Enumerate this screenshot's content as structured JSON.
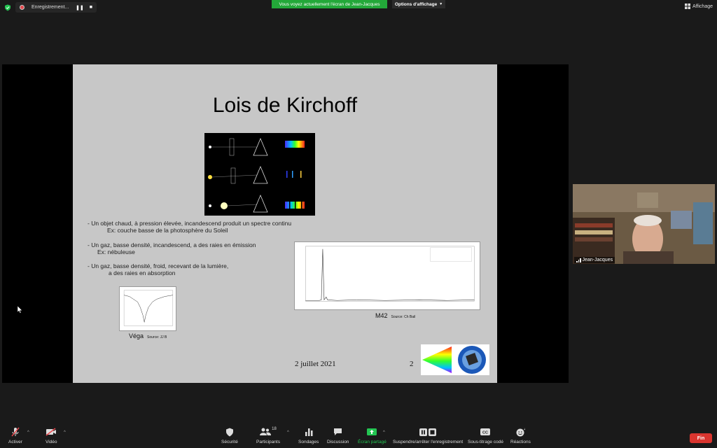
{
  "top_bar": {
    "recording_label": "Enregistrement...",
    "share_banner": "Vous voyez actuellement l'écran de Jean-Jacques",
    "view_options": "Options d'affichage",
    "view_button": "Affichage"
  },
  "slide": {
    "title": "Lois de Kirchoff",
    "bullet1_line1": "- Un objet chaud, à pression élevée, incandescend produit un spectre continu",
    "bullet1_line2": "Ex: couche basse de la photosphère du Soleil",
    "bullet2_line1": "- Un gaz, basse densité, incandescend, a  des raies en émission",
    "bullet2_line2": "Ex: nébuleuse",
    "bullet3_line1": "- Un gaz, basse densité, froid,  recevant de la lumière,",
    "bullet3_line2": "a des raies en absorption",
    "vega_caption": "Véga",
    "vega_source": "Source: JJ B",
    "m42_caption": "M42",
    "m42_source": "Source: Ch Bail",
    "date": "2 juillet 2021",
    "page_number": "2"
  },
  "video": {
    "participant_name": "Jean-Jacques"
  },
  "toolbar": {
    "mute_label": "Activer",
    "video_label": "Vidéo",
    "security_label": "Sécurité",
    "participants_label": "Participants",
    "participants_count": "18",
    "polls_label": "Sondages",
    "chat_label": "Discussion",
    "share_label": "Écran partagé",
    "record_label": "Suspendre/arrêter l'enregistrement",
    "captions_label": "Sous-titrage codé",
    "reactions_label": "Réactions",
    "end_label": "Fin"
  },
  "colors": {
    "banner_green": "#23a839",
    "end_red": "#d9352f",
    "share_green": "#23c552",
    "slide_gray": "#c7c7c7"
  }
}
